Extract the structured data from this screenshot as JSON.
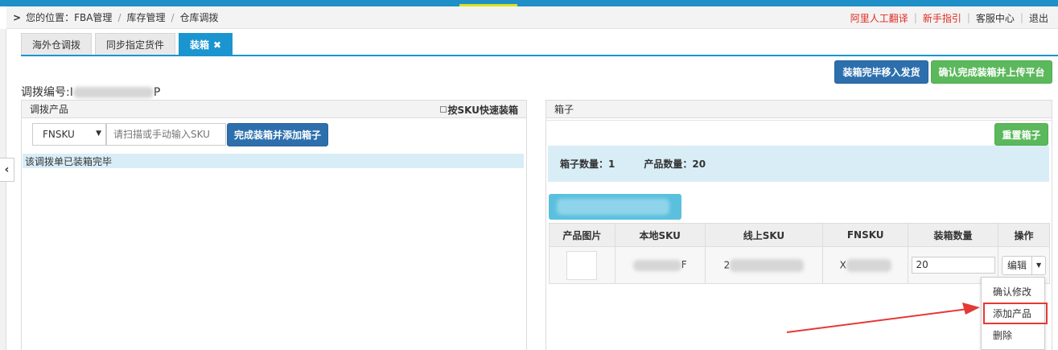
{
  "breadcrumb": {
    "prefix": "您的位置：",
    "items": [
      "FBA管理",
      "库存管理",
      "仓库调拨"
    ]
  },
  "top_links": {
    "translate": "阿里人工翻译",
    "guide": "新手指引",
    "service": "客服中心",
    "logout": "退出"
  },
  "tabs": [
    {
      "label": "海外仓调拨"
    },
    {
      "label": "同步指定货件"
    },
    {
      "label": "装箱",
      "close": "✖"
    }
  ],
  "actions": {
    "move_to_ship": "装箱完毕移入发货",
    "confirm_upload": "确认完成装箱并上传平台"
  },
  "transfer": {
    "label": "调拨编号:",
    "value_prefix": "I",
    "value_suffix": "P"
  },
  "left_panel": {
    "title": "调拨产品",
    "quick_pack_label": "按SKU快速装箱",
    "select_value": "FNSKU",
    "scan_placeholder": "请扫描或手动输入SKU",
    "complete_button": "完成装箱并添加箱子",
    "status_message": "该调拨单已装箱完毕"
  },
  "right_panel": {
    "title": "箱子",
    "reset_button": "重置箱子",
    "box_count_label": "箱子数量：",
    "box_count": "1",
    "product_count_label": "产品数量：",
    "product_count": "20",
    "table": {
      "headers": [
        "产品图片",
        "本地SKU",
        "线上SKU",
        "FNSKU",
        "装箱数量",
        "操作"
      ],
      "row": {
        "local_sku_suffix": "F",
        "online_sku_prefix": "2",
        "fnsku_prefix": "X",
        "quantity": "20",
        "edit_button": "编辑"
      }
    },
    "dropdown": [
      "确认修改",
      "添加产品",
      "删除"
    ]
  },
  "colors": {
    "accent_blue": "#1a95cf",
    "button_blue": "#2d6fad",
    "button_green": "#5cb85c",
    "info_bg": "#d9edf7",
    "alert_red": "#e53935"
  }
}
